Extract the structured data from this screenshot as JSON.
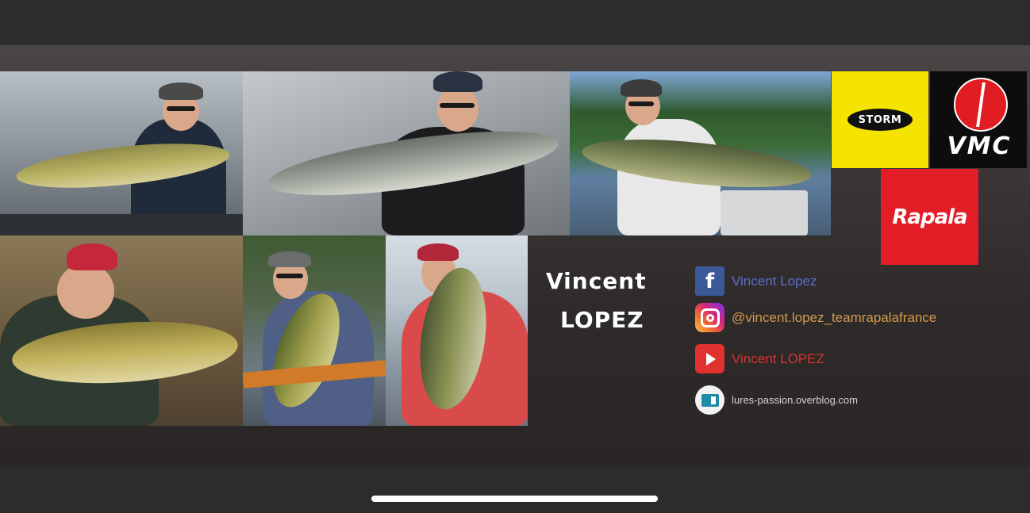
{
  "banner": {
    "name_first": "Vincent",
    "name_last": "LOPEZ"
  },
  "logos": {
    "storm": "STORM",
    "vmc": "VMC",
    "rapala": "Rapala"
  },
  "social": {
    "facebook": {
      "label": "Vincent Lopez",
      "icon": "facebook-icon"
    },
    "instagram": {
      "label": "@vincent.lopez_teamrapalafrance",
      "icon": "instagram-icon"
    },
    "youtube": {
      "label": "Vincent LOPEZ",
      "icon": "youtube-icon"
    },
    "website": {
      "label": "lures-passion.overblog.com",
      "icon": "blog-icon"
    }
  },
  "colors": {
    "storm_yellow": "#f5e400",
    "vmc_red": "#e11c22",
    "rapala_red": "#e21d25",
    "facebook_blue": "#3b5998",
    "youtube_red": "#e0322e"
  }
}
